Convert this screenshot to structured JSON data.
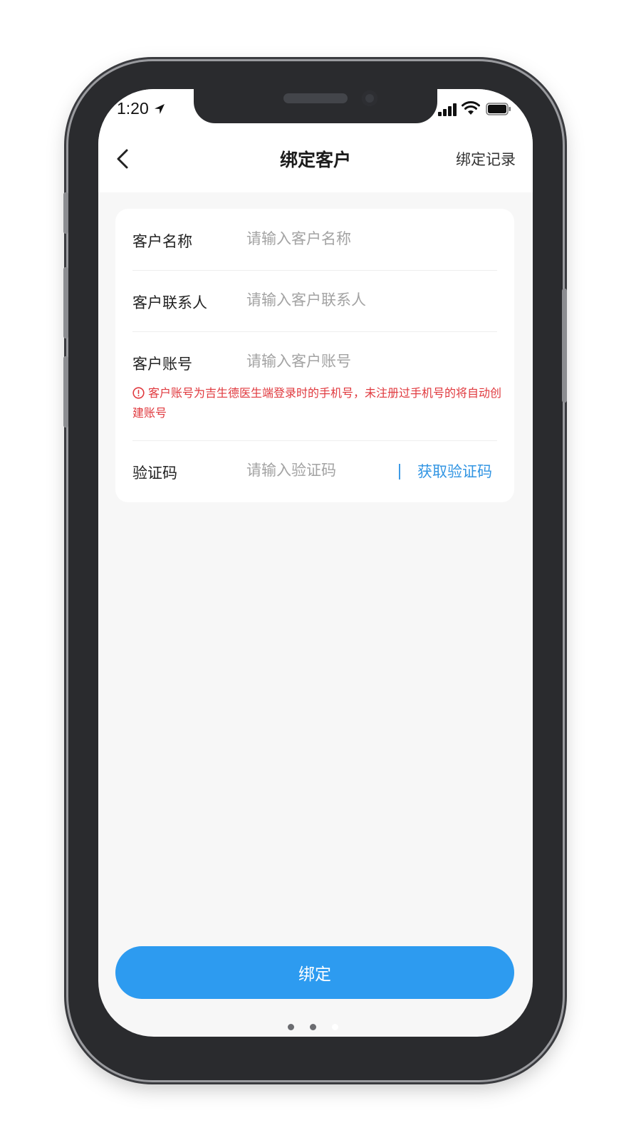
{
  "status_bar": {
    "time": "1:20"
  },
  "nav": {
    "title": "绑定客户",
    "right_action": "绑定记录"
  },
  "form": {
    "customer_name": {
      "label": "客户名称",
      "placeholder": "请输入客户名称",
      "value": ""
    },
    "customer_contact": {
      "label": "客户联系人",
      "placeholder": "请输入客户联系人",
      "value": ""
    },
    "customer_account": {
      "label": "客户账号",
      "placeholder": "请输入客户账号",
      "value": "",
      "hint": "客户账号为吉生德医生端登录时的手机号，未注册过手机号的将自动创建账号"
    },
    "verification_code": {
      "label": "验证码",
      "placeholder": "请输入验证码",
      "value": "",
      "get_code_label": "获取验证码"
    }
  },
  "bind_button": {
    "label": "绑定"
  },
  "colors": {
    "accent": "#2d9bf0",
    "link": "#3295e3",
    "warning": "#e0393e",
    "background": "#f7f7f7"
  },
  "icons": [
    "back-chevron-icon",
    "location-arrow-icon",
    "signal-icon",
    "wifi-icon",
    "battery-icon",
    "warning-circle-icon"
  ]
}
